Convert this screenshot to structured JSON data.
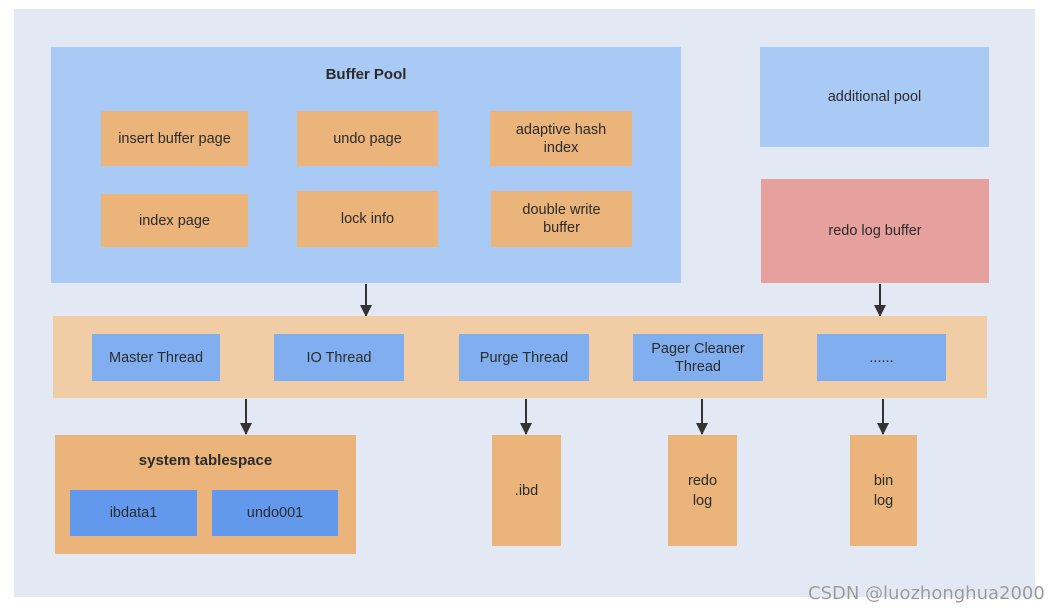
{
  "buffer_pool": {
    "title": "Buffer Pool",
    "items": [
      {
        "label": "insert buffer page"
      },
      {
        "label": "undo page"
      },
      {
        "label": "adaptive hash index"
      },
      {
        "label": "index page"
      },
      {
        "label": "lock info"
      },
      {
        "label": "double write buffer"
      }
    ]
  },
  "additional_pool": {
    "label": "additional pool"
  },
  "redo_log_buffer": {
    "label": "redo log buffer"
  },
  "threads": [
    {
      "label": "Master Thread"
    },
    {
      "label": "IO Thread"
    },
    {
      "label": "Purge Thread"
    },
    {
      "label": "Pager Cleaner Thread"
    },
    {
      "label": "......"
    }
  ],
  "system_tablespace": {
    "title": "system tablespace",
    "files": [
      {
        "label": "ibdata1"
      },
      {
        "label": "undo001"
      }
    ]
  },
  "storage_files": [
    {
      "label": ".ibd"
    },
    {
      "label": "redo log"
    },
    {
      "label": "bin log"
    }
  ],
  "watermark": "CSDN @luozhonghua2000",
  "colors": {
    "background": "#E2E9F5",
    "pool_blue": "#A9CAF5",
    "page_orange": "#EAB47B",
    "thread_bar": "#F1CDA6",
    "thread_blue": "#80AEEE",
    "file_blue": "#6399EC",
    "redo_pink": "#E6A19E"
  }
}
